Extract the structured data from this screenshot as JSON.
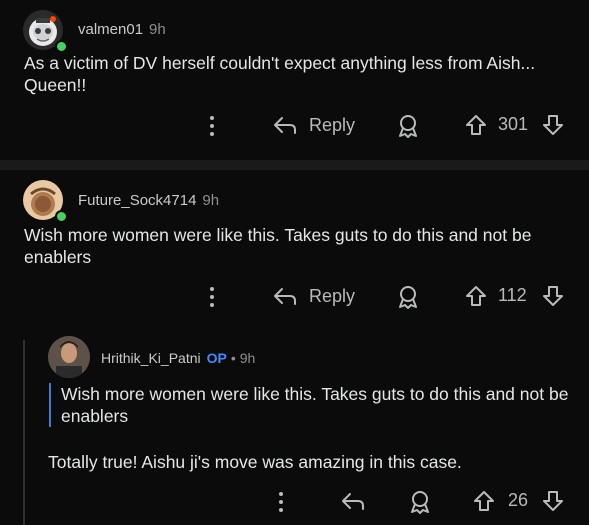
{
  "comments": [
    {
      "username": "valmen01",
      "time": "9h",
      "text": "As a victim of DV herself couldn't expect anything less from Aish... Queen!!",
      "reply_label": "Reply",
      "votes": "301"
    },
    {
      "username": "Future_Sock4714",
      "time": "9h",
      "text": "Wish more women were like this. Takes guts to do this and not be enablers",
      "reply_label": "Reply",
      "votes": "112",
      "reply": {
        "username": "Hrithik_Ki_Patni",
        "op_badge": "OP",
        "separator": "•",
        "time": "9h",
        "quote": "Wish more women were like this. Takes guts to do this and not be enablers",
        "text": "Totally true! Aishu ji's move was amazing in this case.",
        "votes": "26"
      }
    }
  ],
  "colors": {
    "accent_op": "#3d8bff",
    "online": "#46d160",
    "quote_bar": "#3d7cd9"
  }
}
